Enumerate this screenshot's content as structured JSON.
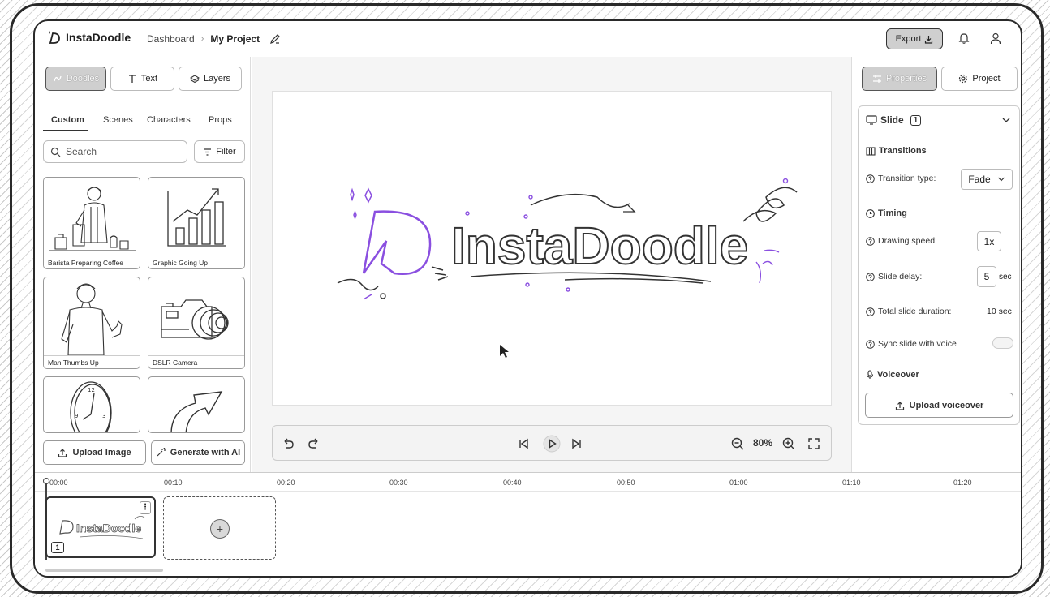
{
  "header": {
    "app_name": "InstaDoodle",
    "breadcrumb_dashboard": "Dashboard",
    "breadcrumb_project": "My Project",
    "export_label": "Export"
  },
  "left_panel": {
    "mode_buttons": [
      {
        "label": "Doodles",
        "icon": "doodle-icon",
        "active": true
      },
      {
        "label": "Text",
        "icon": "text-icon",
        "active": false
      },
      {
        "label": "Layers",
        "icon": "layers-icon",
        "active": false
      }
    ],
    "tabs": [
      "Custom",
      "Scenes",
      "Characters",
      "Props"
    ],
    "active_tab": "Custom",
    "search_placeholder": "Search",
    "filter_label": "Filter",
    "cards": [
      {
        "caption": "Barista Preparing Coffee",
        "icon": "barista-illustration"
      },
      {
        "caption": "Graphic Going Up",
        "icon": "bar-chart-illustration"
      },
      {
        "caption": "Man Thumbs Up",
        "icon": "man-thumbs-up-illustration"
      },
      {
        "caption": "DSLR Camera",
        "icon": "camera-illustration"
      },
      {
        "caption": "",
        "icon": "clock-illustration"
      },
      {
        "caption": "",
        "icon": "arrow-illustration"
      }
    ],
    "upload_image_label": "Upload Image",
    "generate_ai_label": "Generate with AI"
  },
  "canvas": {
    "logo_text": "InstaDoodle",
    "zoom_level": "80%"
  },
  "right_panel": {
    "properties_label": "Properties",
    "project_label": "Project",
    "slide_label": "Slide",
    "slide_number": "1",
    "transitions_header": "Transitions",
    "transition_type_label": "Transition type:",
    "transition_type_value": "Fade",
    "timing_header": "Timing",
    "drawing_speed_label": "Drawing speed:",
    "drawing_speed_value": "1x",
    "slide_delay_label": "Slide delay:",
    "slide_delay_value": "5",
    "slide_delay_unit": "sec",
    "total_duration_label": "Total slide duration:",
    "total_duration_value": "10 sec",
    "sync_voice_label": "Sync slide with voice",
    "sync_voice_on": false,
    "voiceover_header": "Voiceover",
    "upload_voiceover_label": "Upload voiceover"
  },
  "timeline": {
    "ticks": [
      "00:00",
      "00:10",
      "00:20",
      "00:30",
      "00:40",
      "00:50",
      "01:00",
      "01:10",
      "01:20"
    ],
    "slides": [
      {
        "number": "1",
        "thumb_text": "InstaDoodle"
      }
    ]
  },
  "colors": {
    "accent_purple": "#8a4fe0",
    "ink": "#222222",
    "active_button_gray": "#cfcfcf"
  }
}
